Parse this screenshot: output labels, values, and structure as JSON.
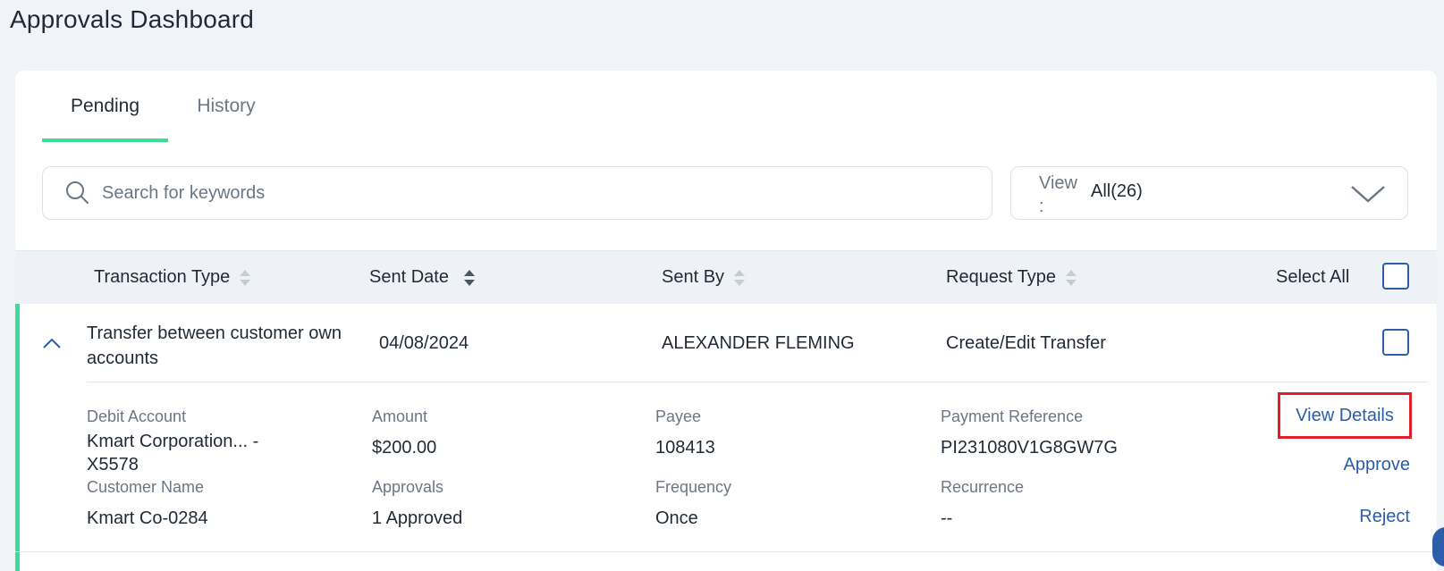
{
  "page": {
    "title": "Approvals Dashboard"
  },
  "tabs": [
    {
      "label": "Pending",
      "active": true
    },
    {
      "label": "History",
      "active": false
    }
  ],
  "search": {
    "placeholder": "Search for keywords",
    "value": "",
    "icon": "search-icon"
  },
  "view_filter": {
    "label": "View :",
    "value": "All(26)",
    "icon": "chevron-down-icon"
  },
  "table": {
    "headers": {
      "transaction_type": "Transaction Type",
      "sent_date": "Sent Date",
      "sent_by": "Sent By",
      "request_type": "Request Type",
      "select_all": "Select All"
    },
    "rows": [
      {
        "transaction_type": "Transfer between customer own accounts",
        "sent_date": "04/08/2024",
        "sent_by": "ALEXANDER FLEMING",
        "request_type": "Create/Edit Transfer",
        "details": {
          "debit_account_label": "Debit Account",
          "debit_account_value": "Kmart Corporation... - X5578",
          "amount_label": "Amount",
          "amount_value": "$200.00",
          "payee_label": "Payee",
          "payee_value": "108413",
          "payment_reference_label": "Payment Reference",
          "payment_reference_value": "PI231080V1G8GW7G",
          "customer_name_label": "Customer Name",
          "customer_name_value": "Kmart Co-0284",
          "approvals_label": "Approvals",
          "approvals_value": "1 Approved",
          "frequency_label": "Frequency",
          "frequency_value": "Once",
          "recurrence_label": "Recurrence",
          "recurrence_value": "--"
        },
        "actions": {
          "view_details": "View Details",
          "approve": "Approve",
          "reject": "Reject"
        }
      }
    ]
  },
  "colors": {
    "accent": "#3ddc97",
    "link": "#2c5da8",
    "highlight_border": "#e0202a",
    "background": "#f0f3f7"
  }
}
